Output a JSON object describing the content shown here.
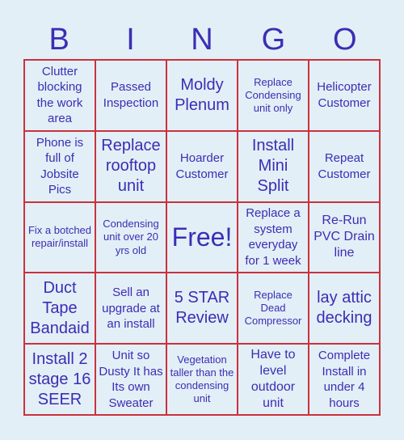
{
  "header": {
    "letters": [
      "B",
      "I",
      "N",
      "G",
      "O"
    ]
  },
  "card": {
    "rows": [
      [
        "Clutter blocking the work area",
        "Passed Inspection",
        "Moldy Plenum",
        "Replace Condensing unit only",
        "Helicopter Customer"
      ],
      [
        "Phone is full of Jobsite Pics",
        "Replace rooftop unit",
        "Hoarder Customer",
        "Install Mini Split",
        "Repeat Customer"
      ],
      [
        "Fix a botched repair/install",
        "Condensing unit over 20 yrs old",
        "Free!",
        "Replace a system everyday for 1 week",
        "Re-Run PVC Drain line"
      ],
      [
        "Duct Tape Bandaid",
        "Sell an upgrade at an install",
        "5 STAR Review",
        "Replace Dead Compressor",
        "lay attic decking"
      ],
      [
        "Install 2 stage 16 SEER",
        "Unit so Dusty It has Its own Sweater",
        "Vegetation taller than the condensing unit",
        "Have to level outdoor unit",
        "Complete Install in under 4 hours"
      ]
    ]
  },
  "colors": {
    "background": "#e3eff6",
    "text": "#3b2db5",
    "border": "#c9323e"
  }
}
